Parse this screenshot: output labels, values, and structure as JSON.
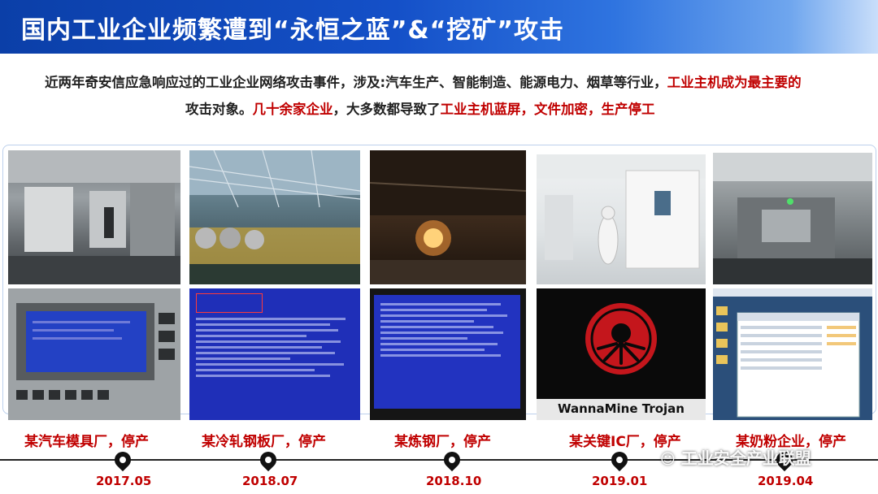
{
  "header": {
    "title": "国内工业企业频繁遭到“永恒之蓝”&“挖矿”攻击"
  },
  "description": {
    "line1_normal": "近两年奇安信应急响应过的工业企业网络攻击事件，涉及:汽车生产、智能制造、能源电力、烟草等行业，",
    "line1_red": "工业主机成为最主要的",
    "line2_normal_a": "攻击对象。",
    "line2_red_a": "几十余家企业",
    "line2_normal_b": "，大多数都导致了",
    "line2_red_b": "工业主机蓝屏，文件加密，生产停工"
  },
  "incidents": [
    {
      "caption": "某汽车模具厂，停产",
      "date": "2017.05"
    },
    {
      "caption": "某冷轧钢板厂，停产",
      "date": "2018.07"
    },
    {
      "caption": "某炼钢厂，停产",
      "date": "2018.10"
    },
    {
      "caption": "某关键IC厂，停产",
      "date": "2019.01"
    },
    {
      "caption": "某奶粉企业，停产",
      "date": "2019.04"
    }
  ],
  "screens": {
    "wannamine_label": "WannaMine Trojan"
  },
  "watermark": "工业安全产业联盟",
  "colors": {
    "title_bar": "#1450c8",
    "highlight_red": "#c00000",
    "bsod_blue": "#1f2fb8"
  }
}
